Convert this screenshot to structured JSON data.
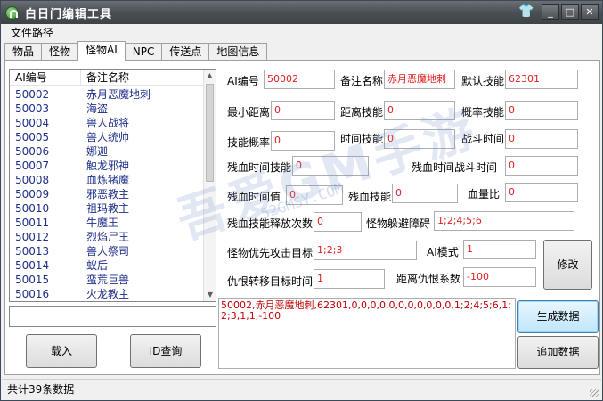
{
  "window": {
    "title": "白日门编辑工具"
  },
  "menu": {
    "file_path": "文件路径"
  },
  "tabs": [
    "物品",
    "怪物",
    "怪物AI",
    "NPC",
    "传送点",
    "地图信息"
  ],
  "list": {
    "col_id": "AI编号",
    "col_name": "备注名称",
    "rows": [
      {
        "id": "50002",
        "name": "赤月恶魔地刺"
      },
      {
        "id": "50003",
        "name": "海盗"
      },
      {
        "id": "50004",
        "name": "兽人战将"
      },
      {
        "id": "50005",
        "name": "兽人统帅"
      },
      {
        "id": "50006",
        "name": "娜迦"
      },
      {
        "id": "50007",
        "name": "触龙邪神"
      },
      {
        "id": "50008",
        "name": "血炼猪魔"
      },
      {
        "id": "50009",
        "name": "邪恶教主"
      },
      {
        "id": "50010",
        "name": "祖玛教主"
      },
      {
        "id": "50011",
        "name": "牛魔王"
      },
      {
        "id": "50012",
        "name": "烈焰尸王"
      },
      {
        "id": "50013",
        "name": "兽人祭司"
      },
      {
        "id": "50014",
        "name": "蚁后"
      },
      {
        "id": "50015",
        "name": "蛮荒巨兽"
      },
      {
        "id": "50016",
        "name": "火龙教主"
      }
    ]
  },
  "form": {
    "ai_id_label": "AI编号",
    "ai_id": "50002",
    "note_label": "备注名称",
    "note": "赤月恶魔地刺",
    "default_skill_label": "默认技能",
    "default_skill": "62301",
    "min_dist_label": "最小距离",
    "min_dist": "0",
    "dist_skill_label": "距离技能",
    "dist_skill": "0",
    "prob_skill_label": "概率技能",
    "prob_skill": "0",
    "skill_prob_label": "技能概率",
    "skill_prob": "0",
    "time_skill_label": "时间技能",
    "time_skill": "0",
    "battle_time_label": "战斗时间",
    "battle_time": "0",
    "lowhp_time_skill_label": "残血时间技能",
    "lowhp_time_skill": "0",
    "lowhp_battle_time_label": "残血时间战斗时间",
    "lowhp_battle_time": "0",
    "lowhp_time_val_label": "残血时间值",
    "lowhp_time_val": "0",
    "lowhp_skill_label": "残血技能",
    "lowhp_skill": "0",
    "hp_ratio_label": "血量比",
    "hp_ratio": "0",
    "lowhp_skill_count_label": "残血技能释放次数",
    "lowhp_skill_count": "0",
    "avoid_label": "怪物躲避障碍",
    "avoid": "1;2;4;5;6",
    "priority_label": "怪物优先攻击目标",
    "priority": "1;2;3",
    "ai_mode_label": "AI模式",
    "ai_mode": "1",
    "hate_target_label": "仇恨转移目标时间",
    "hate_target": "1",
    "hate_dist_label": "距离仇恨系数",
    "hate_dist": "-100"
  },
  "buttons": {
    "modify": "修改",
    "generate": "生成数据",
    "append": "追加数据",
    "load": "载入",
    "id_query": "ID查询"
  },
  "output_text": "50002,赤月恶魔地刺,62301,0,0,0,0,0,0,0,0,0,0,0,1;2;4;5;6,1;2;3,1,1,-100",
  "status": {
    "total": "共计39条数据"
  },
  "watermark": {
    "main": "吾爱GM手游",
    "sub": "52GMSY.COM"
  }
}
